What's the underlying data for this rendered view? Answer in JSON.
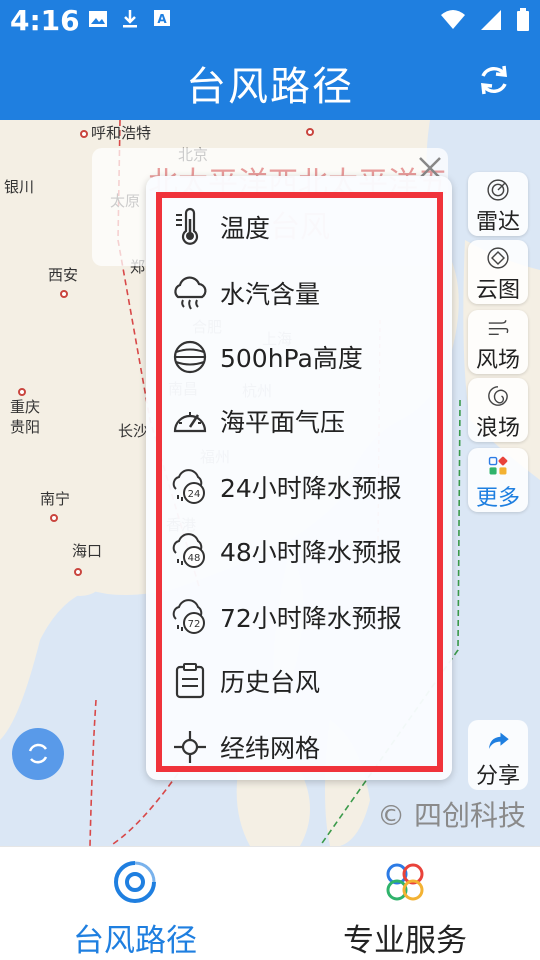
{
  "status": {
    "time": "4:16"
  },
  "app": {
    "title": "台风路径"
  },
  "map": {
    "cities": [
      "呼和浩特",
      "北京",
      "银川",
      "太原",
      "西安",
      "郑",
      "合肥",
      "上海",
      "南昌",
      "杭州",
      "福州",
      "重庆",
      "贵阳",
      "长沙",
      "南宁",
      "香港",
      "海口"
    ],
    "watermark": "© 四创科技",
    "back_panel": {
      "line1": "北太平洋西北太平洋五",
      "line2": "台风"
    }
  },
  "side_buttons": [
    {
      "label": "雷达",
      "icon": "radar-icon"
    },
    {
      "label": "云图",
      "icon": "satellite-icon"
    },
    {
      "label": "风场",
      "icon": "wind-icon"
    },
    {
      "label": "浪场",
      "icon": "wave-icon"
    },
    {
      "label": "更多",
      "icon": "grid-icon"
    }
  ],
  "share": {
    "label": "分享"
  },
  "menu": {
    "items": [
      {
        "label": "温度",
        "icon": "thermometer-icon"
      },
      {
        "label": "水汽含量",
        "icon": "vapor-icon"
      },
      {
        "label": "500hPa高度",
        "icon": "globe-icon"
      },
      {
        "label": "海平面气压",
        "icon": "gauge-icon"
      },
      {
        "label": "24小时降水预报",
        "icon": "rain-24-icon",
        "badge": "24"
      },
      {
        "label": "48小时降水预报",
        "icon": "rain-48-icon",
        "badge": "48"
      },
      {
        "label": "72小时降水预报",
        "icon": "rain-72-icon",
        "badge": "72"
      },
      {
        "label": "历史台风",
        "icon": "history-icon"
      },
      {
        "label": "经纬网格",
        "icon": "crosshair-icon"
      }
    ]
  },
  "tabs": [
    {
      "label": "台风路径",
      "icon": "typhoon-icon",
      "active": true
    },
    {
      "label": "专业服务",
      "icon": "clover-icon",
      "active": false
    }
  ],
  "colors": {
    "primary": "#1f7fe0",
    "highlight": "#f0333b",
    "active_tab": "#1f7fe0"
  }
}
